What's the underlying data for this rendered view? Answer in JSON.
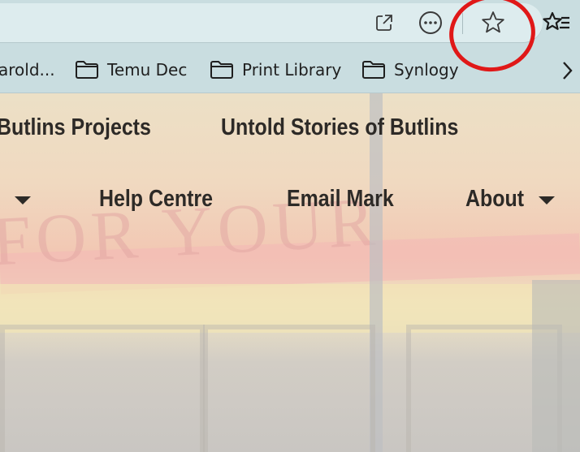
{
  "toolbar": {
    "icons": [
      "open-in-app-icon",
      "more-options-icon",
      "star-icon",
      "favorites-list-icon"
    ]
  },
  "bookmarks": {
    "items": [
      {
        "label": "arold...",
        "icon": "folder-icon"
      },
      {
        "label": "Temu Dec",
        "icon": "folder-icon"
      },
      {
        "label": "Print Library",
        "icon": "folder-icon"
      },
      {
        "label": "Synlogy",
        "icon": "folder-icon"
      }
    ],
    "overflow_icon": "chevron-right-icon"
  },
  "site_nav": {
    "row1": [
      "Butlins Projects",
      "Untold Stories of Butlins"
    ],
    "row2": [
      "Help Centre",
      "Email Mark",
      "About"
    ]
  },
  "annotation": {
    "color": "#e01818",
    "target": "star-icon"
  }
}
